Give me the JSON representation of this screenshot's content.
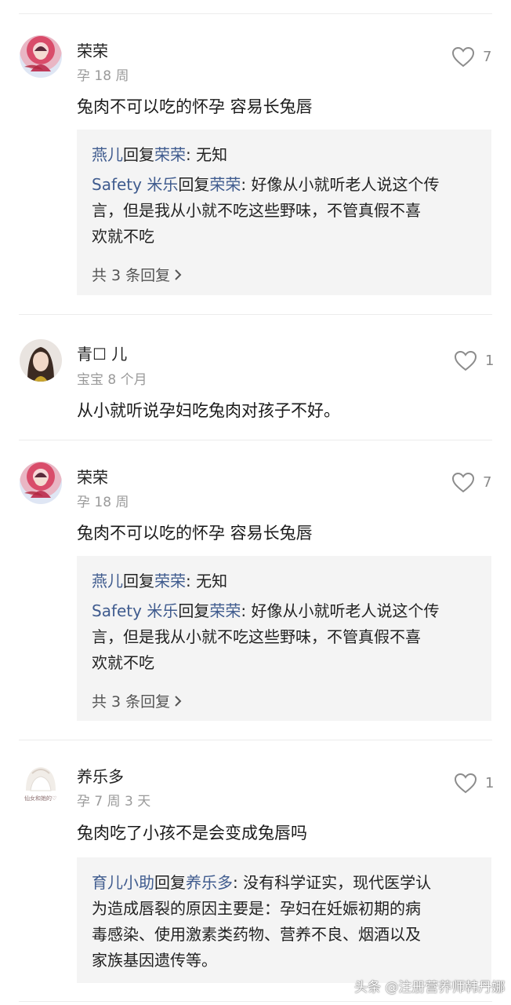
{
  "comments": [
    {
      "username": "荣荣",
      "meta": "孕 18 周",
      "text": "兔肉不可以吃的怀孕 容易长兔唇",
      "likes": "7",
      "replies": [
        {
          "author": "燕儿",
          "verb": "回复",
          "target": "荣荣",
          "text": ": 无知"
        },
        {
          "author": "Safety 米乐",
          "verb": "回复",
          "target": "荣荣",
          "text": ": 好像从小就听老人说这个传",
          "cont": [
            "言，但是我从小就不吃这些野味，不管真假不喜",
            "欢就不吃"
          ]
        }
      ],
      "more_label": "共 3 条回复"
    },
    {
      "username": "青☐ 儿",
      "meta": "宝宝 8 个月",
      "text": "从小就听说孕妇吃兔肉对孩子不好。",
      "likes": "1"
    },
    {
      "username": "荣荣",
      "meta": "孕 18 周",
      "text": "兔肉不可以吃的怀孕 容易长兔唇",
      "likes": "7",
      "replies": [
        {
          "author": "燕儿",
          "verb": "回复",
          "target": "荣荣",
          "text": ": 无知"
        },
        {
          "author": "Safety 米乐",
          "verb": "回复",
          "target": "荣荣",
          "text": ": 好像从小就听老人说这个传",
          "cont": [
            "言，但是我从小就不吃这些野味，不管真假不喜",
            "欢就不吃"
          ]
        }
      ],
      "more_label": "共 3 条回复"
    },
    {
      "username": "养乐多",
      "meta": "孕 7 周 3 天",
      "avatar_caption": "仙女和她的♡",
      "text": "兔肉吃了小孩不是会变成兔唇吗",
      "likes": "1",
      "replies": [
        {
          "author": "育儿小助",
          "verb": "回复",
          "target": "养乐多",
          "text": ": 没有科学证实，现代医学认",
          "cont": [
            "为造成唇裂的原因主要是：孕妇在妊娠初期的病",
            "毒感染、使用激素类药物、营养不良、烟酒以及",
            "家族基因遗传等。"
          ]
        }
      ]
    }
  ],
  "watermark": "头条 @注册营养师韩丹娜",
  "colors": {
    "link": "#3f5b8e",
    "reply_bg": "#f4f4f4",
    "meta": "#9a9a9a"
  },
  "icons": {
    "like": "heart-outline-icon",
    "more": "chevron-right-icon"
  }
}
